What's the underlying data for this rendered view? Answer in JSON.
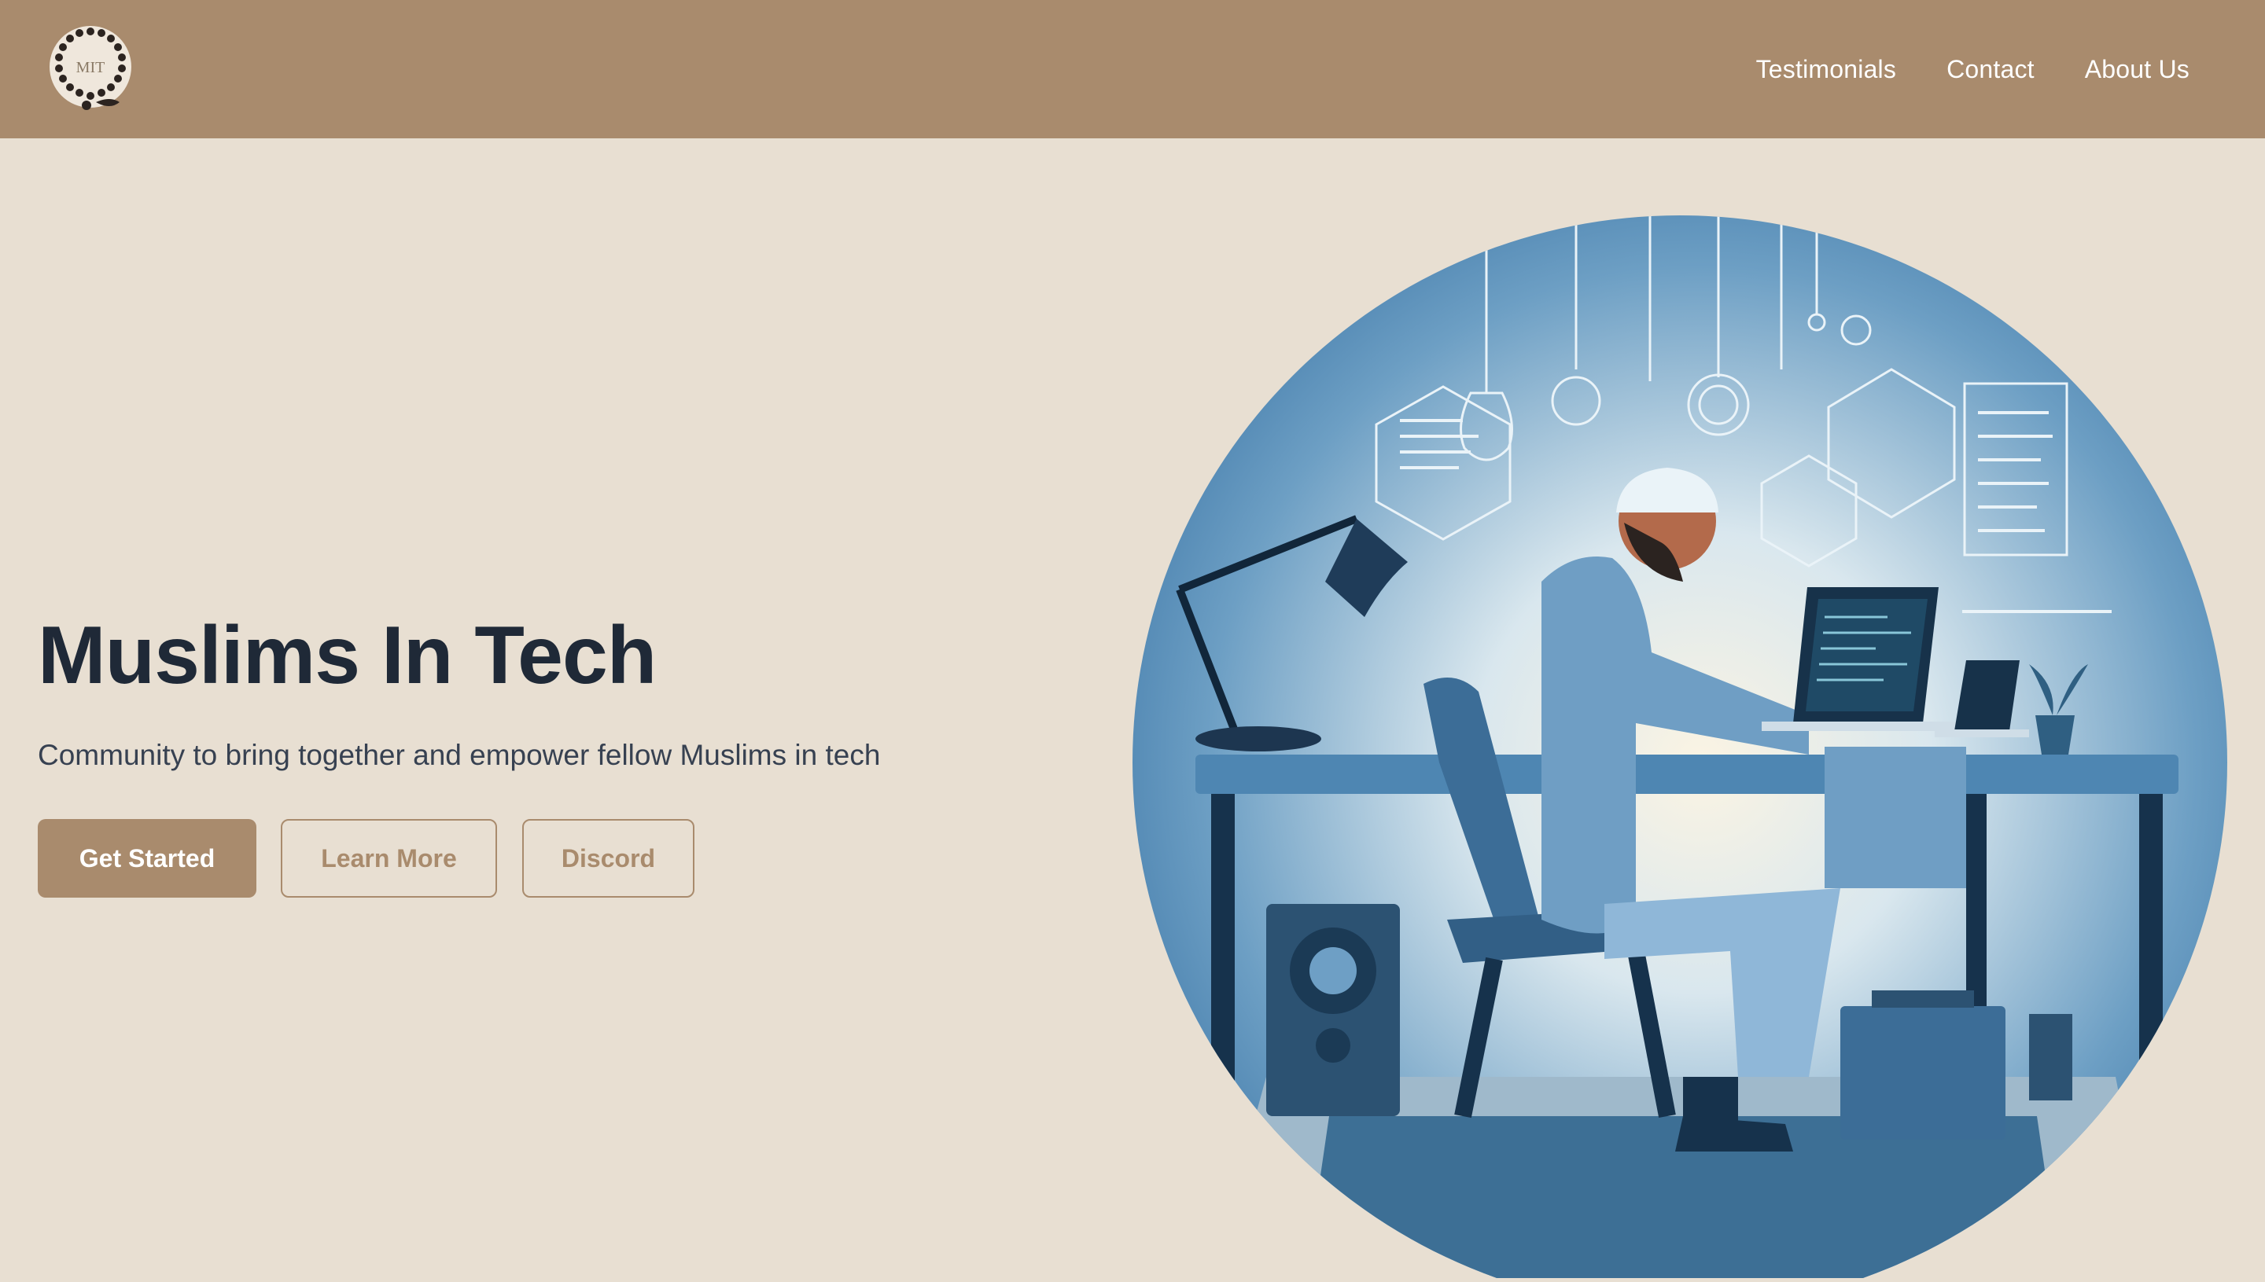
{
  "brand": {
    "logo_text": "MIT",
    "logo_icon": "prayer-beads-icon"
  },
  "nav": {
    "links": [
      {
        "label": "Testimonials"
      },
      {
        "label": "Contact"
      },
      {
        "label": "About Us"
      }
    ]
  },
  "hero": {
    "title": "Muslims In Tech",
    "subtitle": "Community to bring together and empower fellow Muslims in tech",
    "buttons": {
      "primary": "Get Started",
      "secondary": "Learn More",
      "tertiary": "Discord"
    }
  },
  "colors": {
    "navbar": "#a98b6d",
    "background": "#e8dfd2",
    "title": "#1f2937",
    "accent": "#a98b6d",
    "illustration_blue": "#3f78a8"
  }
}
